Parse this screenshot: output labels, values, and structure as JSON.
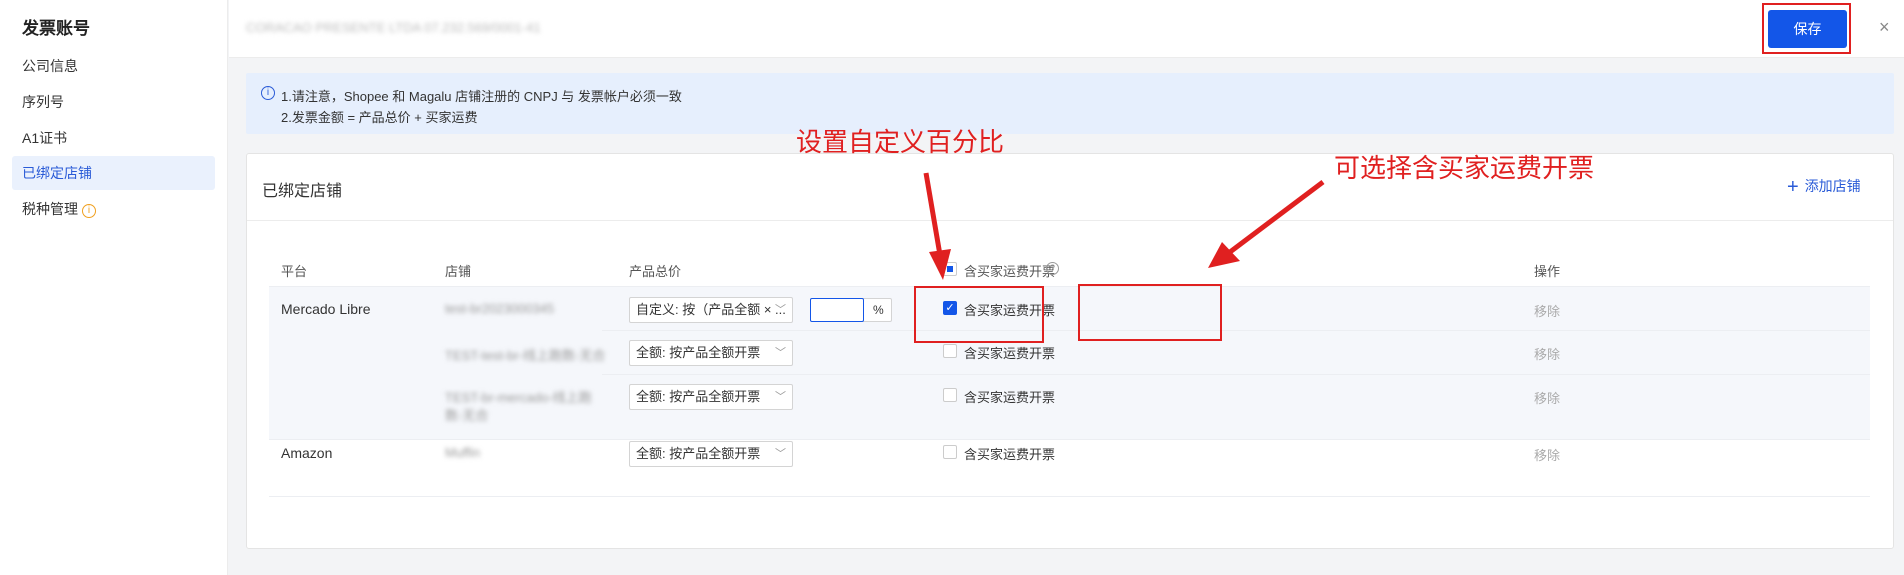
{
  "sidebar": {
    "title": "发票账号",
    "items": [
      {
        "label": "公司信息"
      },
      {
        "label": "序列号"
      },
      {
        "label": "A1证书"
      },
      {
        "label": "已绑定店铺"
      },
      {
        "label": "税种管理"
      }
    ],
    "tax_info_icon": "i"
  },
  "topbar": {
    "company": "CORACAO PRESENTE LTDA  07.232.569/0001-41",
    "save_label": "保存",
    "close_icon": "×"
  },
  "notice": {
    "line1": "1.请注意，Shopee 和 Magalu 店铺注册的 CNPJ 与 发票帐户必须一致",
    "line2": "2.发票金额 = 产品总价 + 买家运费",
    "icon": "i"
  },
  "card": {
    "title": "已绑定店铺",
    "add_store": "添加店铺",
    "add_icon": "+"
  },
  "table": {
    "headers": {
      "platform": "平台",
      "store": "店铺",
      "product_total": "产品总价",
      "shipping": "含买家运费开票",
      "action": "操作"
    },
    "rows": [
      {
        "platform": "Mercado Libre",
        "store": "test-br2023000345",
        "amount_mode": "自定义: 按（产品全额 × ...",
        "shipping_label": "含买家运费开票",
        "shipping_checked": true,
        "remove": "移除",
        "percent": "",
        "percent_sign": "%"
      },
      {
        "platform": "",
        "store": "TEST-test-br-线上跑数-无合",
        "amount_mode": "全额: 按产品全额开票",
        "shipping_label": "含买家运费开票",
        "shipping_checked": false,
        "remove": "移除"
      },
      {
        "platform": "",
        "store": "TEST-br-mercado-线上跑数-无合",
        "amount_mode": "全额: 按产品全额开票",
        "shipping_label": "含买家运费开票",
        "shipping_checked": false,
        "remove": "移除"
      },
      {
        "platform": "Amazon",
        "store": "Muffin",
        "amount_mode": "全额: 按产品全额开票",
        "shipping_label": "含买家运费开票",
        "shipping_checked": false,
        "remove": "移除"
      }
    ]
  },
  "annotations": {
    "percent": "设置自定义百分比",
    "shipping": "可选择含买家运费开票",
    "color": "#e02020"
  },
  "colors": {
    "accent": "#1356e8",
    "active_bg": "#eaf1fd",
    "notice_bg": "#e6effd"
  }
}
